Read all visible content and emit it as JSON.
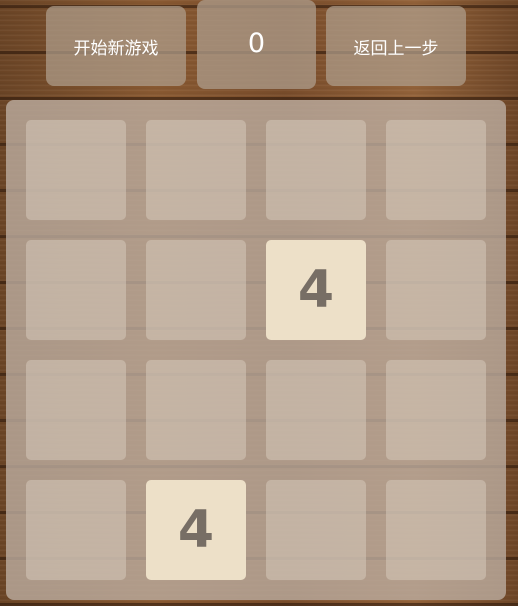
{
  "controls": {
    "new_game_label": "开始新游戏",
    "undo_label": "返回上一步"
  },
  "score": {
    "value": "0"
  },
  "board": {
    "rows": [
      [
        "",
        "",
        "",
        ""
      ],
      [
        "",
        "",
        "4",
        ""
      ],
      [
        "",
        "",
        "",
        ""
      ],
      [
        "",
        "4",
        "",
        ""
      ]
    ]
  },
  "colors": {
    "tile_4": "#ede0c8",
    "tile_text": "#776e65"
  }
}
